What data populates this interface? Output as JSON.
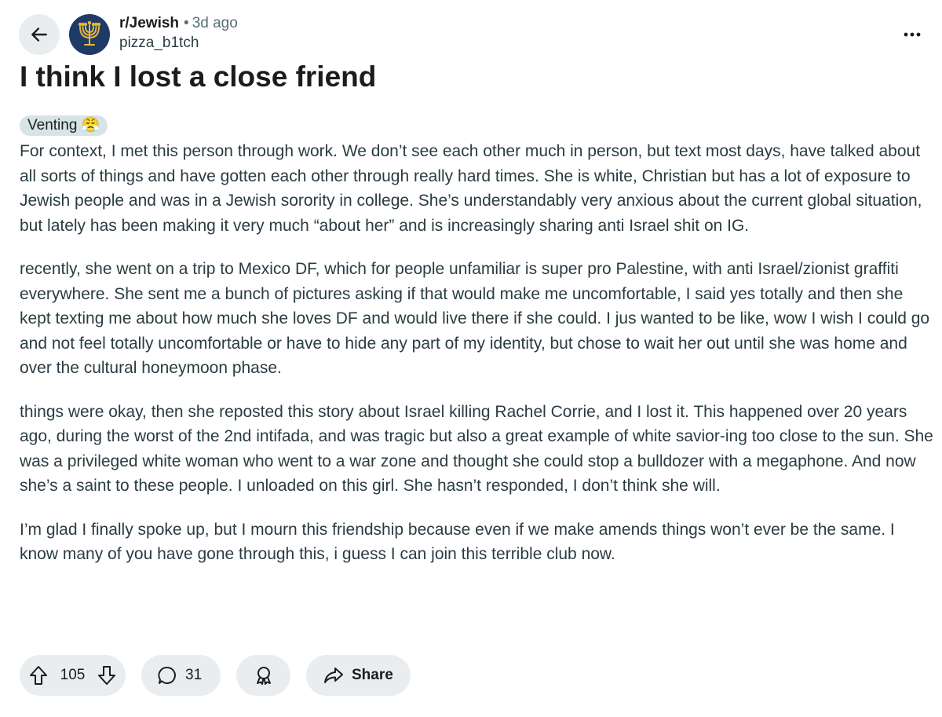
{
  "header": {
    "subreddit": "r/Jewish",
    "separator": "•",
    "age": "3d ago",
    "username": "pizza_b1tch"
  },
  "post": {
    "title": "I think I lost a close friend",
    "flair": "Venting 😤",
    "paragraphs": [
      "For context, I met this person through work. We don’t see each other much in person, but text most days, have talked about all sorts of things and have gotten each other through really hard times. She is white, Christian but has a lot of exposure to Jewish people and was in a Jewish sorority in college. She’s understandably very anxious about the current global situation, but lately has been making it very much “about her” and is increasingly sharing anti Israel shit on IG.",
      "recently, she went on a trip to Mexico DF, which for people unfamiliar is super pro Palestine, with anti Israel/zionist graffiti everywhere. She sent me a bunch of pictures asking if that would make me uncomfortable, I said yes totally and then she kept texting me about how much she loves DF and would live there if she could. I jus wanted to be like, wow I wish I could go and not feel totally uncomfortable or have to hide any part of my identity, but chose to wait her out until she was home and over the cultural honeymoon phase.",
      "things were okay, then she reposted this story about Israel killing Rachel Corrie, and I lost it. This happened over 20 years ago, during the worst of the 2nd intifada, and was tragic but also a great example of white savior-ing too close to the sun. She was a privileged white woman who went to a war zone and thought she could stop a bulldozer with a megaphone. And now she’s a saint to these people. I unloaded on this girl. She hasn’t responded, I don’t think she will.",
      "I’m glad I finally spoke up, but I mourn this friendship because even if we make amends things won’t ever be the same. I know many of you have gone through this, i guess I can join this terrible club now."
    ]
  },
  "actions": {
    "votes": "105",
    "comments": "31",
    "share_label": "Share"
  },
  "colors": {
    "button_bg": "#eaedef",
    "flair_bg": "#d6e4e6",
    "avatar_bg": "#1f3a66",
    "menorah": "#e8b73a",
    "meta_text": "#576f76",
    "body_text": "#2a3c42"
  },
  "icons": {
    "back": "arrow-left-icon",
    "avatar": "menorah-icon",
    "more": "more-horizontal-icon",
    "upvote": "arrow-up-icon",
    "downvote": "arrow-down-icon",
    "comment": "comment-bubble-icon",
    "award": "award-icon",
    "share": "share-arrow-icon"
  }
}
